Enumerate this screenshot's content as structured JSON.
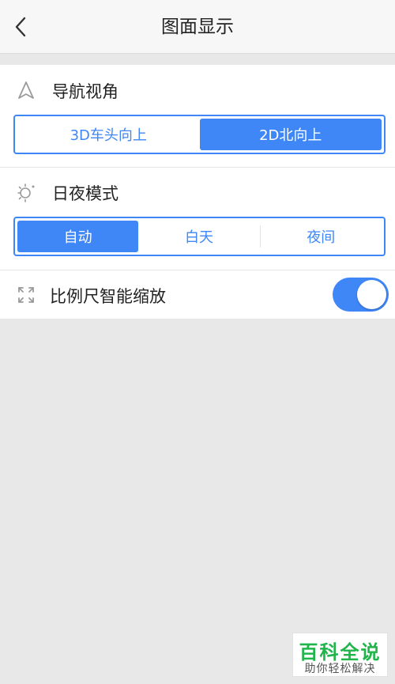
{
  "header": {
    "title": "图面显示",
    "back_icon": "chevron-left-icon"
  },
  "sections": {
    "nav_view": {
      "label": "导航视角",
      "icon": "navigation-arrow-icon",
      "options": [
        "3D车头向上",
        "2D北向上"
      ],
      "selected": "2D北向上"
    },
    "day_night": {
      "label": "日夜模式",
      "icon": "sun-moon-icon",
      "options": [
        "自动",
        "白天",
        "夜间"
      ],
      "selected": "自动"
    },
    "scale_zoom": {
      "label": "比例尺智能缩放",
      "icon": "expand-icon",
      "enabled": true
    }
  },
  "watermark": {
    "main": "百科全说",
    "sub": "助你轻松解决"
  },
  "colors": {
    "accent": "#3f86f7",
    "watermark_green": "#1fb54a"
  }
}
